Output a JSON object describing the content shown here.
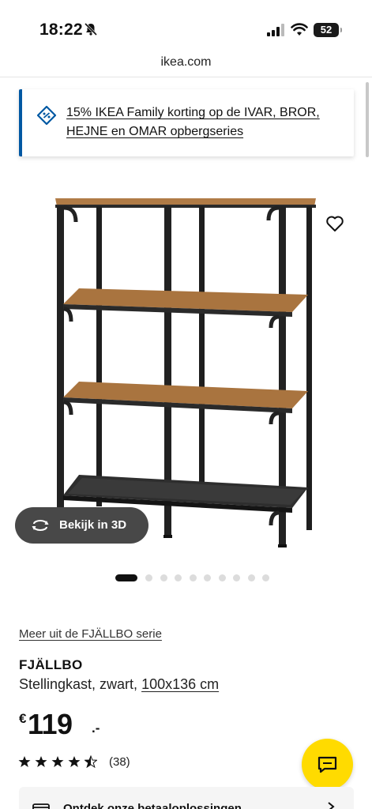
{
  "status_bar": {
    "time": "18:22",
    "battery": "52",
    "icons": [
      "bell-slash-icon",
      "cellular-signal-icon",
      "wifi-icon",
      "battery-icon"
    ]
  },
  "browser": {
    "url": "ikea.com"
  },
  "promo": {
    "icon": "discount-tag-icon",
    "text": "15% IKEA Family korting op de IVAR, BROR, HEJNE en OMAR opbergseries",
    "accent_color": "#0058a3"
  },
  "gallery": {
    "view_3d_label": "Bekijk in 3D",
    "dot_count": 10,
    "active_index": 0,
    "favorite_icon": "heart-icon"
  },
  "product": {
    "series_link": "Meer uit de FJÄLLBO serie",
    "name": "FJÄLLBO",
    "description": "Stellingkast, zwart, ",
    "dimensions": "100x136 cm",
    "price_currency": "€",
    "price_integer": "119",
    "price_decimal": ".-",
    "rating_stars": 4.5,
    "rating_max": 5,
    "review_count": "(38)"
  },
  "chat": {
    "icon": "chat-bubble-icon",
    "color": "#ffdb00"
  },
  "payment": {
    "label": "Ontdek onze betaaloplossingen",
    "icon": "payment-icon"
  }
}
